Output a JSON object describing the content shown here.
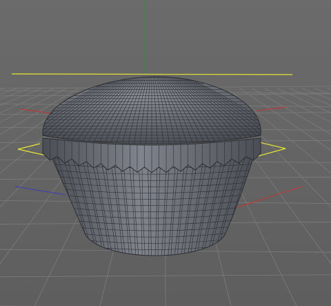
{
  "viewport": {
    "background_top": "#6b6b6b",
    "background_bottom": "#5e5e5e",
    "grid_color": "#7d7d7d",
    "grid_shadow_color": "#555555"
  },
  "axes": {
    "y_axis_color": "#3c8a3c",
    "x_axis_color": "#c83232",
    "z_axis_color": "#3c3cb4",
    "bounding_box_color": "#e6e632"
  },
  "model": {
    "name": "cupcake",
    "mesh_color": "#6e727a",
    "mesh_shadow_color": "#4a4d54",
    "wire_color": "#2c2e33",
    "frosting_highlight_color": "#8a8e96",
    "wrapper_highlight_color": "#80848c"
  }
}
